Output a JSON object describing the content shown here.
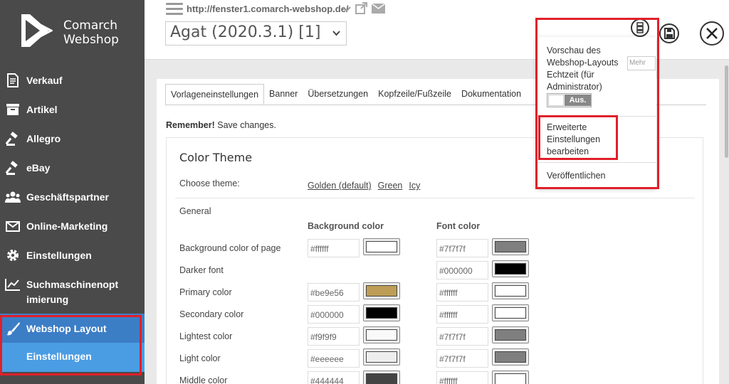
{
  "brand": {
    "line1": "Comarch",
    "line2": "Webshop"
  },
  "sidebar": {
    "items": [
      {
        "label": "Verkauf",
        "icon": "document-icon"
      },
      {
        "label": "Artikel",
        "icon": "archive-box-icon"
      },
      {
        "label": "Allegro",
        "icon": "gavel-icon"
      },
      {
        "label": "eBay",
        "icon": "gavel-icon"
      },
      {
        "label": "Geschäftspartner",
        "icon": "users-icon"
      },
      {
        "label": "Online-Marketing",
        "icon": "envelope-icon"
      },
      {
        "label": "Einstellungen",
        "icon": "gear-icon"
      },
      {
        "label": "Suchmaschinenopt",
        "label2": "imierung",
        "icon": "chart-line-icon"
      },
      {
        "label": "Webshop Layout",
        "icon": "paintbrush-icon"
      }
    ],
    "subitem": "Einstellungen",
    "active_color": "#3c7ec6",
    "sub_color": "#4b9de3"
  },
  "header": {
    "url": "http://fenster1.comarch-webshop.de/",
    "theme_select": "Agat (2020.3.1) [1]"
  },
  "tabs": [
    {
      "label": "Vorlageneinstellungen",
      "active": true
    },
    {
      "label": "Banner"
    },
    {
      "label": "Übersetzungen"
    },
    {
      "label": "Kopfzeile/Fußzeile"
    },
    {
      "label": "Dokumentation"
    }
  ],
  "remember": {
    "bold": "Remember!",
    "text": " Save changes."
  },
  "theme": {
    "title": "Color Theme",
    "choose_label": "Choose theme:",
    "choices": [
      "Golden (default)",
      "Green",
      "Icy"
    ],
    "general": "General",
    "bg_head": "Background color",
    "font_head": "Font color",
    "rows": [
      {
        "label": "Background color of page",
        "bg": "#ffffff",
        "font": "#7f7f7f"
      },
      {
        "label": "Darker font",
        "bg": null,
        "font": "#000000"
      },
      {
        "label": "Primary color",
        "bg": "#be9e56",
        "font": "#ffffff"
      },
      {
        "label": "Secondary color",
        "bg": "#000000",
        "font": "#ffffff"
      },
      {
        "label": "Lightest color",
        "bg": "#f9f9f9",
        "font": "#7f7f7f"
      },
      {
        "label": "Light color",
        "bg": "#eeeeee",
        "font": "#7f7f7f"
      },
      {
        "label": "Middle color",
        "bg": "#444444",
        "font": "#ffffff"
      }
    ]
  },
  "dropdown": {
    "preview_lines": [
      "Vorschau des",
      "Webshop-Layouts",
      "Echtzeit (für",
      "Administrator)"
    ],
    "mehr_placeholder": "Mehr",
    "toggle_label": "Aus.",
    "advanced_lines": [
      "Erweiterte",
      "Einstellungen",
      "bearbeiten"
    ],
    "publish": "Veröffentlichen"
  },
  "highlight_color": "#e0202a"
}
